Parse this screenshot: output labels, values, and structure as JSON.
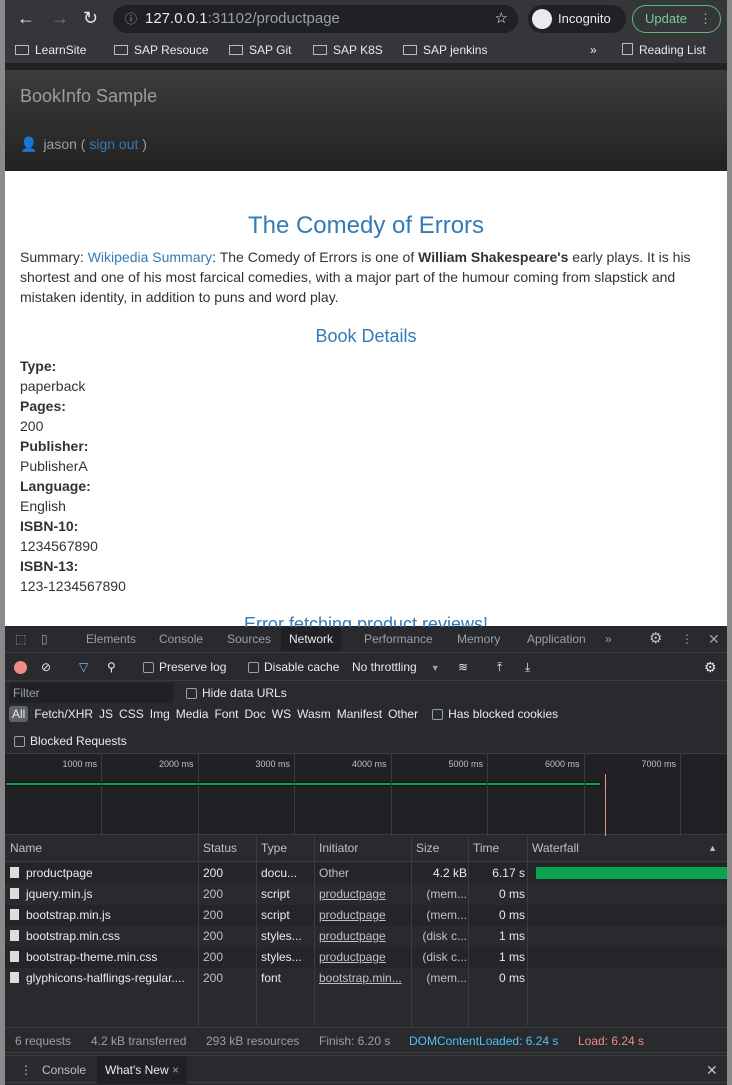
{
  "browser": {
    "url_host": "127.0.0.1",
    "url_path": ":31102/productpage",
    "incognito": "Incognito",
    "update": "Update",
    "bookmarks": [
      "LearnSite",
      "SAP Resouce",
      "SAP Git",
      "SAP K8S",
      "SAP jenkins"
    ],
    "reading_list": "Reading List"
  },
  "app": {
    "brand": "BookInfo Sample",
    "user": "jason",
    "sign_out": "sign out"
  },
  "book": {
    "title": "The Comedy of Errors",
    "summary_label": "Summary: ",
    "summary_link": "Wikipedia Summary",
    "summary_a": ": The Comedy of Errors is one of ",
    "summary_bold": "William Shakespeare's",
    "summary_b": " early plays. It is his shortest and one of his most farcical comedies, with a major part of the humour coming from slapstick and mistaken identity, in addition to puns and word play.",
    "details_heading": "Book Details",
    "details": [
      {
        "label": "Type:",
        "value": "paperback"
      },
      {
        "label": "Pages:",
        "value": "200"
      },
      {
        "label": "Publisher:",
        "value": "PublisherA"
      },
      {
        "label": "Language:",
        "value": "English"
      },
      {
        "label": "ISBN-10:",
        "value": "1234567890"
      },
      {
        "label": "ISBN-13:",
        "value": "123-1234567890"
      }
    ],
    "reviews_error": "Error fetching product reviews!"
  },
  "devtools": {
    "tabs": [
      "Elements",
      "Console",
      "Sources",
      "Network",
      "Performance",
      "Memory",
      "Application"
    ],
    "active_tab": "Network",
    "preserve_log": "Preserve log",
    "disable_cache": "Disable cache",
    "throttling": "No throttling",
    "filter_placeholder": "Filter",
    "hide_data_urls": "Hide data URLs",
    "types": [
      "All",
      "Fetch/XHR",
      "JS",
      "CSS",
      "Img",
      "Media",
      "Font",
      "Doc",
      "WS",
      "Wasm",
      "Manifest",
      "Other"
    ],
    "has_blocked_cookies": "Has blocked cookies",
    "blocked_requests": "Blocked Requests",
    "ticks": [
      "1000 ms",
      "2000 ms",
      "3000 ms",
      "4000 ms",
      "5000 ms",
      "6000 ms",
      "7000 ms"
    ],
    "columns": [
      "Name",
      "Status",
      "Type",
      "Initiator",
      "Size",
      "Time",
      "Waterfall"
    ],
    "rows": [
      [
        "productpage",
        "200",
        "docu...",
        "Other",
        "4.2 kB",
        "6.17 s"
      ],
      [
        "jquery.min.js",
        "200",
        "script",
        "productpage",
        "(mem...",
        "0 ms"
      ],
      [
        "bootstrap.min.js",
        "200",
        "script",
        "productpage",
        "(mem...",
        "0 ms"
      ],
      [
        "bootstrap.min.css",
        "200",
        "styles...",
        "productpage",
        "(disk c...",
        "1 ms"
      ],
      [
        "bootstrap-theme.min.css",
        "200",
        "styles...",
        "productpage",
        "(disk c...",
        "1 ms"
      ],
      [
        "glyphicons-halflings-regular....",
        "200",
        "font",
        "bootstrap.min...",
        "(mem...",
        "0 ms"
      ]
    ],
    "footer": {
      "requests": "6 requests",
      "transferred": "4.2 kB transferred",
      "resources": "293 kB resources",
      "finish": "Finish: 6.20 s",
      "dcl": "DOMContentLoaded: 6.24 s",
      "load": "Load: 6.24 s"
    },
    "drawer": {
      "console": "Console",
      "whats_new": "What's New"
    },
    "colors": {
      "dcl": "#4fc3f7",
      "load": "#f28b82",
      "bar": "#0aa34f",
      "accent": "#337ab7"
    }
  }
}
